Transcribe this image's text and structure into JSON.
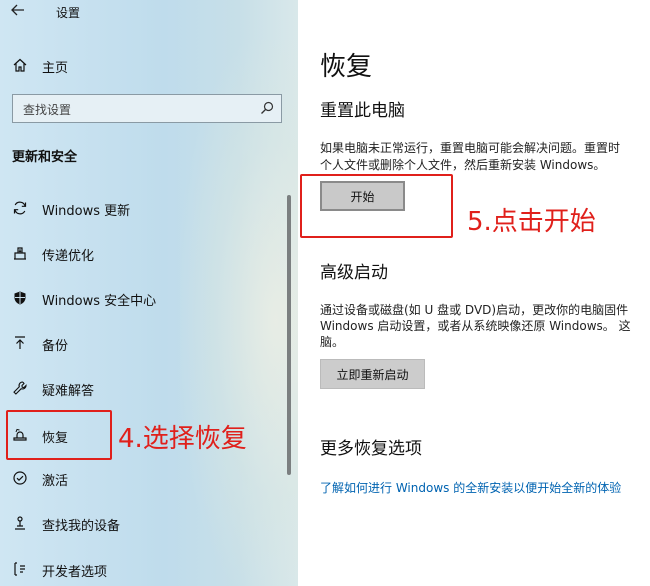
{
  "window": {
    "title": "设置"
  },
  "sidebar": {
    "home_label": "主页",
    "search_placeholder": "查找设置",
    "section_title": "更新和安全",
    "items": [
      {
        "label": "Windows 更新",
        "icon": "sync-icon"
      },
      {
        "label": "传递优化",
        "icon": "delivery-optimization-icon"
      },
      {
        "label": "Windows 安全中心",
        "icon": "shield-icon"
      },
      {
        "label": "备份",
        "icon": "backup-arrow-icon"
      },
      {
        "label": "疑难解答",
        "icon": "wrench-icon"
      },
      {
        "label": "恢复",
        "icon": "recovery-icon",
        "selected": true
      },
      {
        "label": "激活",
        "icon": "check-circle-icon"
      },
      {
        "label": "查找我的设备",
        "icon": "person-locate-icon"
      },
      {
        "label": "开发者选项",
        "icon": "developer-icon"
      }
    ]
  },
  "main": {
    "title": "恢复",
    "reset": {
      "heading": "重置此电脑",
      "desc_line1": "如果电脑未正常运行，重置电脑可能会解决问题。重置时",
      "desc_line2": "个人文件或删除个人文件，然后重新安装 Windows。",
      "button": "开始"
    },
    "advanced": {
      "heading": "高级启动",
      "desc_line1": "通过设备或磁盘(如 U 盘或 DVD)启动，更改你的电脑固件",
      "desc_line2": "Windows 启动设置，或者从系统映像还原 Windows。 这",
      "desc_line3": "脑。",
      "button": "立即重新启动"
    },
    "more": {
      "heading": "更多恢复选项",
      "link": "了解如何进行 Windows 的全新安装以便开始全新的体验"
    }
  },
  "annotations": {
    "step4": "4.选择恢复",
    "step5": "5.点击开始",
    "color": "#e0201b"
  },
  "colors": {
    "link": "#0063b1",
    "sidebar_bg": "#c4def0"
  }
}
